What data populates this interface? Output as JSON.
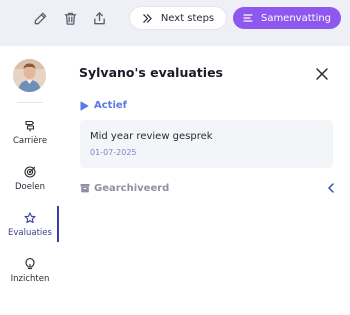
{
  "toolbar": {
    "icons": [
      "pencil-icon",
      "trash-icon",
      "share-icon"
    ],
    "next_steps_label": "Next steps",
    "summary_label": "Samenvatting"
  },
  "sidebar": {
    "items": [
      {
        "label": "Carrière",
        "icon": "career-icon"
      },
      {
        "label": "Doelen",
        "icon": "target-icon"
      },
      {
        "label": "Evaluaties",
        "icon": "star-icon",
        "active": true
      },
      {
        "label": "Inzichten",
        "icon": "lightbulb-icon"
      }
    ]
  },
  "main": {
    "title": "Sylvano's evaluaties",
    "active_section_label": "Actief",
    "reviews": [
      {
        "title": "Mid year review gesprek",
        "date": "01-07-2025"
      }
    ],
    "archived_section_label": "Gearchiveerd"
  },
  "colors": {
    "accent_purple": "#8e58ee",
    "active_blue": "#5a78e6",
    "date_blue": "#7a86cc",
    "sidebar_active": "#3a3ea8"
  }
}
